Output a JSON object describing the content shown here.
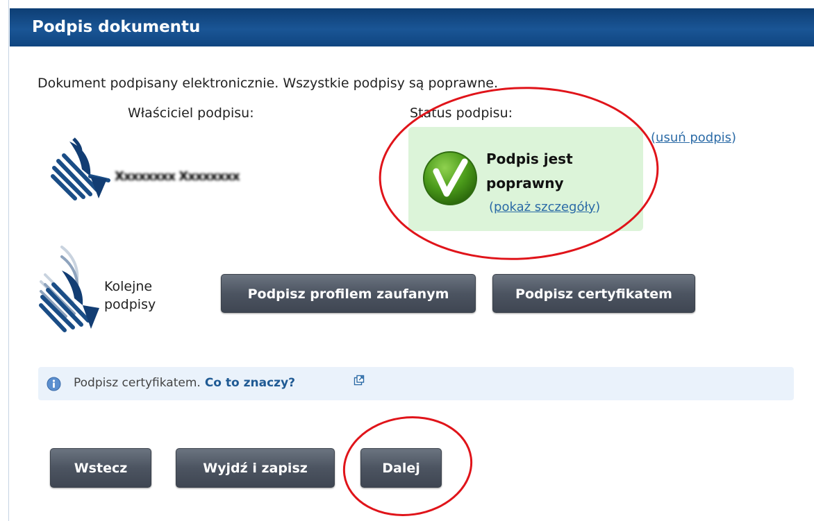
{
  "header": {
    "title": "Podpis dokumentu"
  },
  "intro_text": "Dokument podpisany elektronicznie. Wszystkie podpisy są poprawne.",
  "columns": {
    "owner": "Właściciel podpisu:",
    "status": "Status podpisu:"
  },
  "signature": {
    "owner_name_redacted": "Xxxxxxxx Xxxxxxxx",
    "status_line1": "Podpis jest",
    "status_line2": "poprawny",
    "details_link": "pokaż szczegóły",
    "remove_link": "usuń podpis",
    "paren_open": "(",
    "paren_close": ")"
  },
  "next_signatures": {
    "line1": "Kolejne",
    "line2": "podpisy"
  },
  "buttons": {
    "sign_profile": "Podpisz profilem zaufanym",
    "sign_certificate": "Podpisz certyfikatem",
    "back": "Wstecz",
    "exit_save": "Wyjdź i zapisz",
    "next": "Dalej"
  },
  "info": {
    "text": "Podpisz certyfikatem.",
    "link": "Co to znaczy?"
  },
  "icons": {
    "signature_logo": "signature-logo-icon",
    "check": "check-icon",
    "info": "info-icon",
    "external": "external-link-icon"
  },
  "colors": {
    "header_bg": "#1a5595",
    "status_bg": "#dcf4d9",
    "check_green": "#4a9a1a",
    "link": "#2a6aa6",
    "button_bg": "#4c5461",
    "annotation_red": "#e0141a"
  }
}
